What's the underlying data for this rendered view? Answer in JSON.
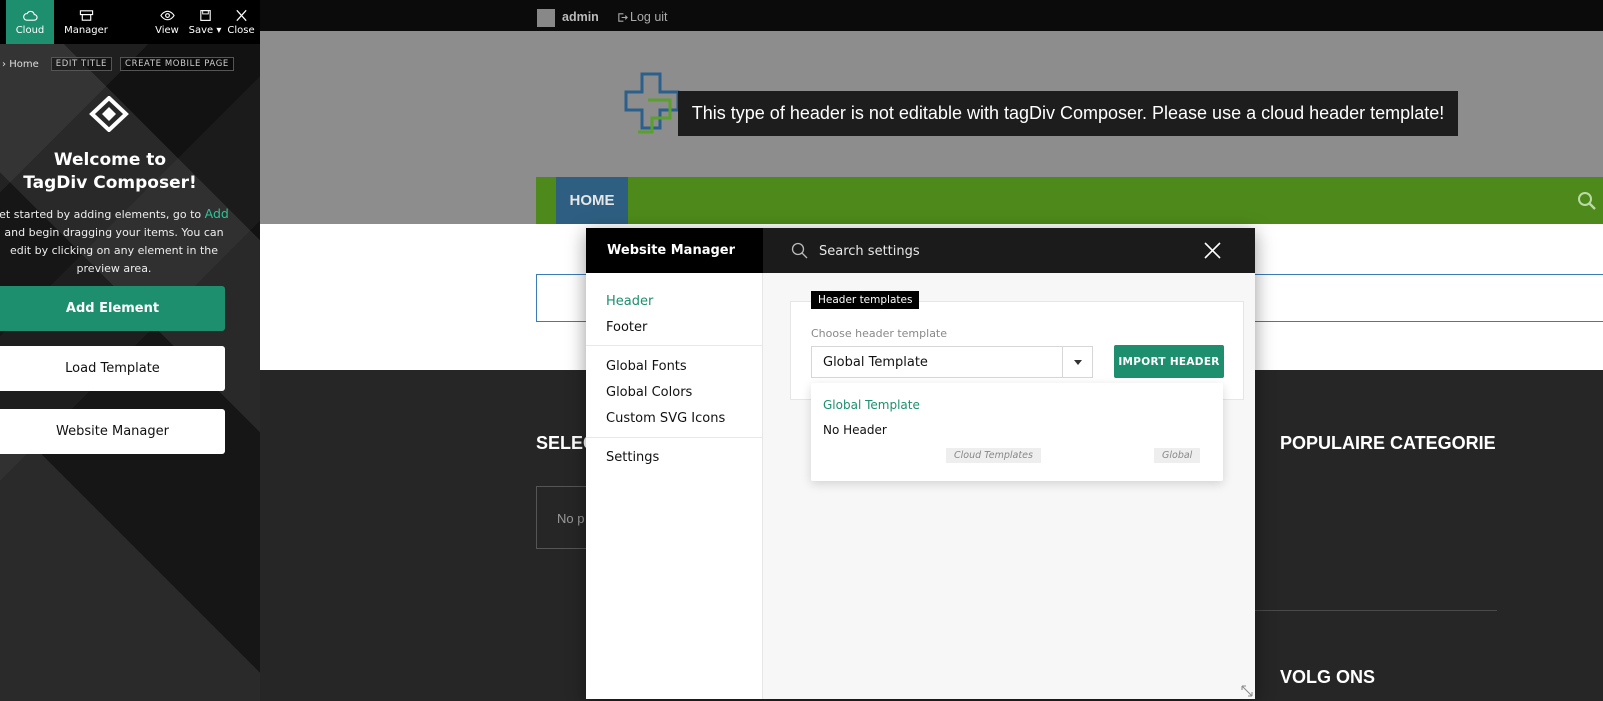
{
  "toolbar": {
    "cloud": "Cloud",
    "manager": "Manager",
    "view": "View",
    "save": "Save",
    "close": "Close"
  },
  "breadcrumb": {
    "home": "Home",
    "edit_title": "EDIT TITLE",
    "create_mobile": "CREATE MOBILE PAGE"
  },
  "welcome": {
    "title_line1": "Welcome to",
    "title_line2": "TagDiv Composer!",
    "text_before": "et started by adding elements, go to",
    "text_add": "Add",
    "text_after": "and begin dragging your items. You can edit by clicking on any element in the preview area."
  },
  "sidebar_buttons": {
    "add_element": "Add Element",
    "load_template": "Load Template",
    "website_manager": "Website Manager"
  },
  "admin_bar": {
    "user": "admin",
    "logout": "Log uit"
  },
  "header_notice": "This type of header is not editable with tagDiv Composer. Please use a cloud header template!",
  "nav": {
    "home": "HOME"
  },
  "footer": {
    "select_heading": "SELEC",
    "select_box_text": "No p",
    "populaire": "POPULAIRE CATEGORIE",
    "volg_ons": "VOLG ONS"
  },
  "modal": {
    "title": "Website Manager",
    "search_placeholder": "Search settings",
    "nav": {
      "header": "Header",
      "footer": "Footer",
      "global_fonts": "Global Fonts",
      "global_colors": "Global Colors",
      "custom_svg_icons": "Custom SVG Icons",
      "settings": "Settings"
    },
    "panel_tag": "Header templates",
    "choose_label": "Choose header template",
    "selected_value": "Global Template",
    "import_button": "IMPORT HEADER",
    "dropdown": {
      "option_1": "Global Template",
      "option_2": "No Header",
      "tag_cloud": "Cloud Templates",
      "tag_global": "Global"
    }
  },
  "colors": {
    "accent_green": "#1d8f6e",
    "nav_green": "#4e8a1b",
    "nav_home_blue": "#2e5f82"
  }
}
